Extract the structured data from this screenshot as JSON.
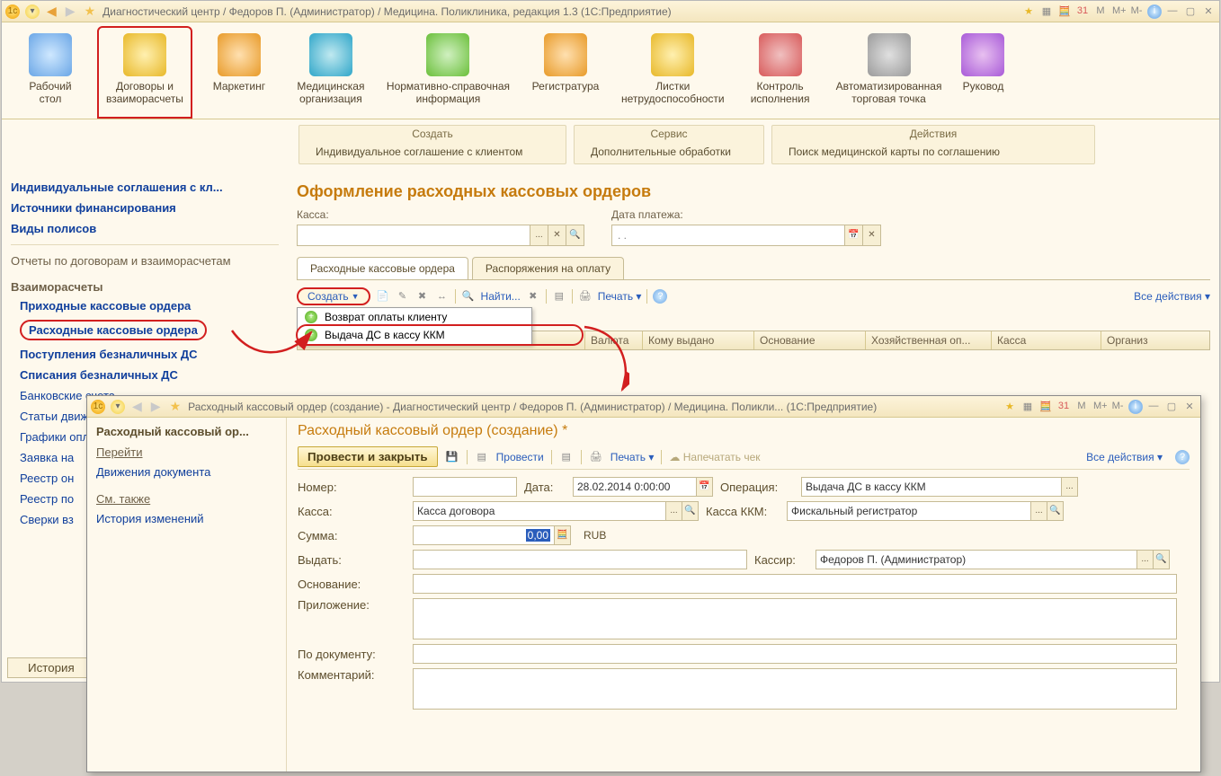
{
  "main": {
    "title": "Диагностический центр / Федоров П. (Администратор) / Медицина. Поликлиника, редакция 1.3  (1С:Предприятие)",
    "titlebar_right_letters": [
      "M",
      "M+",
      "M-"
    ],
    "toolbar": [
      {
        "label": "Рабочий\nстол"
      },
      {
        "label": "Договоры и\nвзаиморасчеты",
        "selected": true
      },
      {
        "label": "Маркетинг"
      },
      {
        "label": "Медицинская\nорганизация"
      },
      {
        "label": "Нормативно-справочная\nинформация"
      },
      {
        "label": "Регистратура"
      },
      {
        "label": "Листки\nнетрудоспособности"
      },
      {
        "label": "Контроль\nисполнения"
      },
      {
        "label": "Автоматизированная\nторговая точка"
      },
      {
        "label": "Руковод"
      }
    ],
    "midboxes": [
      {
        "head": "Создать",
        "body": "Индивидуальное соглашение с клиентом"
      },
      {
        "head": "Сервис",
        "body": "Дополнительные обработки"
      },
      {
        "head": "Действия",
        "body": "Поиск медицинской карты по соглашению"
      }
    ]
  },
  "sidebar": {
    "top_links": [
      "Индивидуальные соглашения с кл...",
      "Источники финансирования",
      "Виды полисов"
    ],
    "reports": "Отчеты по договорам и взаиморасчетам",
    "group": "Взаиморасчеты",
    "sub": [
      "Приходные кассовые ордера",
      "Расходные кассовые ордера",
      "Поступления безналичных ДС",
      "Списания безналичных ДС",
      "Банковские счета",
      "Статьи движения денежных средств",
      "Графики оплаты",
      "Заявка на",
      "Реестр он",
      "Реестр по",
      "Сверки вз"
    ],
    "history": "История"
  },
  "content": {
    "title": "Оформление расходных кассовых ордеров",
    "filters": {
      "kassa_label": "Касса:",
      "date_label": "Дата платежа:",
      "date_placeholder": ". ."
    },
    "tabs": [
      "Расходные кассовые ордера",
      "Распоряжения на оплату"
    ],
    "create_btn": "Создать",
    "find": "Найти...",
    "print": "Печать",
    "all_actions": "Все действия",
    "dropdown": [
      "Возврат оплаты клиенту",
      "Выдача ДС в кассу ККМ"
    ],
    "grid_cols": [
      "",
      "Валюта",
      "Кому выдано",
      "Основание",
      "Хозяйственная оп...",
      "Касса",
      "Организ"
    ]
  },
  "child": {
    "title": "Расходный кассовый ордер (создание) - Диагностический центр / Федоров П. (Администратор) / Медицина. Поликли...  (1С:Предприятие)",
    "side": {
      "title": "Расходный кассовый ор...",
      "h1": "Перейти",
      "l1": "Движения документа",
      "h2": "См. также",
      "l2": "История изменений"
    },
    "main": {
      "title": "Расходный кассовый ордер (создание) *",
      "toolbar": {
        "primary": "Провести и закрыть",
        "provest": "Провести",
        "print": "Печать",
        "cheque": "Напечатать чек",
        "all": "Все действия"
      },
      "fields": {
        "number": "Номер:",
        "number_val": "",
        "date": "Дата:",
        "date_val": "28.02.2014 0:00:00",
        "operation": "Операция:",
        "operation_val": "Выдача ДС в кассу ККМ",
        "kassa": "Касса:",
        "kassa_val": "Касса договора",
        "kassa_kkm": "Касса ККМ:",
        "kassa_kkm_val": "Фискальный регистратор",
        "sum": "Сумма:",
        "sum_val": "0,00",
        "currency": "RUB",
        "vydat": "Выдать:",
        "vydat_val": "",
        "kassir": "Кассир:",
        "kassir_val": "Федоров П. (Администратор)",
        "osn": "Основание:",
        "osn_val": "",
        "pril": "Приложение:",
        "pril_val": "",
        "podoc": "По документу:",
        "podoc_val": "",
        "comment": "Комментарий:",
        "comment_val": ""
      }
    }
  }
}
